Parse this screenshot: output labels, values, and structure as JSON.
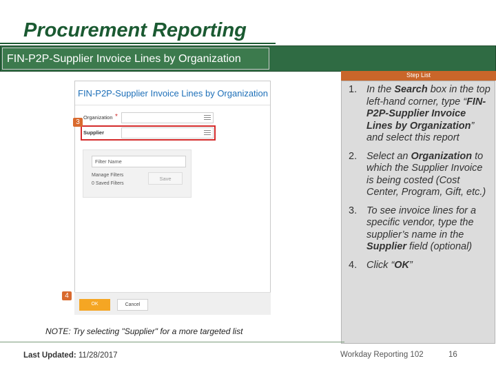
{
  "slide": {
    "title": "Procurement Reporting",
    "banner": "FIN-P2P-Supplier Invoice Lines by Organization",
    "step_list_label": "Step List",
    "note": "NOTE: Try selecting \"Supplier\" for a more targeted list",
    "footer": {
      "last_updated_label": "Last Updated:",
      "last_updated_date": "11/28/2017",
      "course": "Workday Reporting 102",
      "page_number": "16"
    }
  },
  "steps": [
    {
      "num": "1.",
      "parts": [
        [
          "In the ",
          false
        ],
        [
          "Search",
          true
        ],
        [
          " box in the top left-hand corner, type “",
          false
        ],
        [
          "FIN-P2P-Supplier Invoice Lines by Organization",
          true
        ],
        [
          "” and select this report",
          false
        ]
      ]
    },
    {
      "num": "2.",
      "parts": [
        [
          "Select an ",
          false
        ],
        [
          "Organization",
          true
        ],
        [
          " to which the Supplier Invoice is being costed (Cost Center, Program, Gift, etc.)",
          false
        ]
      ]
    },
    {
      "num": "3.",
      "parts": [
        [
          "To see invoice lines for a specific vendor, type the supplier’s name in the ",
          false
        ],
        [
          "Supplier",
          true
        ],
        [
          " field (optional)",
          false
        ]
      ]
    },
    {
      "num": "4.",
      "parts": [
        [
          "Click “",
          false
        ],
        [
          "OK",
          true
        ],
        [
          "”",
          false
        ]
      ]
    }
  ],
  "mockup": {
    "report_title": "FIN-P2P-Supplier Invoice Lines by Organization",
    "organization_label": "Organization",
    "required_mark": "*",
    "supplier_label": "Supplier",
    "filter_placeholder": "Filter Name",
    "manage_filters": "Manage Filters",
    "saved_filters": "0 Saved Filters",
    "save_label": "Save",
    "ok_label": "OK",
    "cancel_label": "Cancel"
  },
  "callouts": {
    "three": "3",
    "four": "4"
  },
  "colors": {
    "brand_green": "#1b5a32",
    "banner_green": "#2f6b43",
    "accent_orange": "#c9662a",
    "highlight_red": "#d42a2a",
    "ok_orange": "#f5a623"
  },
  "icons": [
    "prompt-list-icon"
  ]
}
